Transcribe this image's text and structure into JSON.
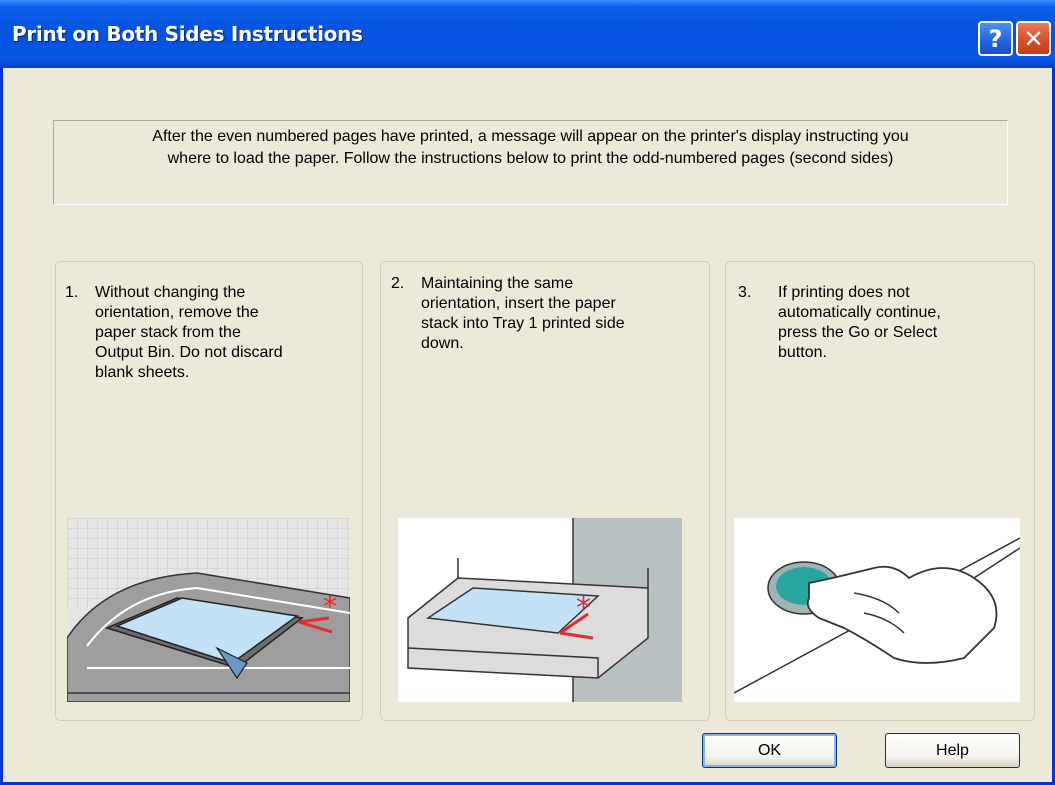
{
  "window": {
    "title": "Print on Both Sides Instructions",
    "help_icon": "?",
    "close_icon": "✕",
    "title_color": "#0553df"
  },
  "intro": {
    "line1": "After the even numbered pages have printed, a message will appear on the printer's display instructing you",
    "line2": "where to load the paper. Follow the instructions below to print the odd-numbered pages (second sides)"
  },
  "steps": [
    {
      "num": "1.",
      "lines": [
        "Without changing the",
        "orientation, remove the",
        "paper stack from the",
        "Output Bin.  Do not discard",
        "blank sheets."
      ],
      "illustration": "output-bin-paper-stack-icon"
    },
    {
      "num": "2.",
      "lines": [
        "Maintaining the same",
        "orientation, insert the paper",
        "stack into Tray 1 printed side",
        "down."
      ],
      "illustration": "tray-insert-paper-icon"
    },
    {
      "num": "3.",
      "lines": [
        "If printing does not",
        "automatically continue,",
        "press the Go or Select",
        "button."
      ],
      "illustration": "finger-press-button-icon"
    }
  ],
  "buttons": {
    "ok": "OK",
    "help": "Help"
  }
}
